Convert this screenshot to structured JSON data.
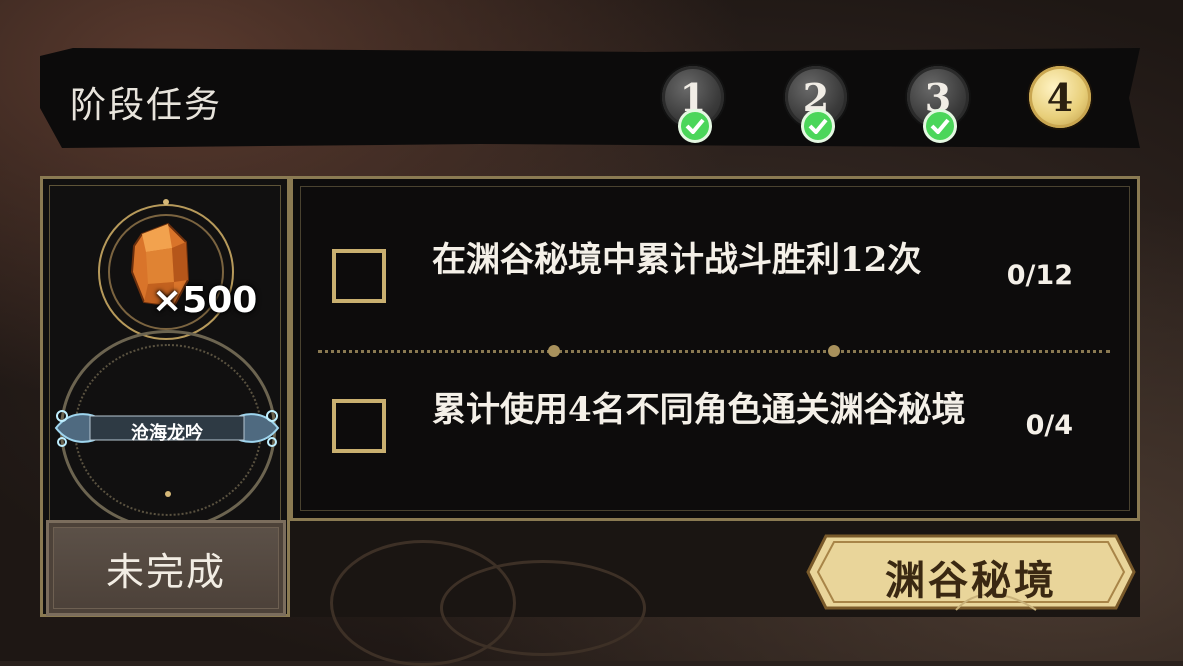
{
  "header": {
    "title": "阶段任务",
    "stages": [
      {
        "label": "1",
        "completed": true
      },
      {
        "label": "2",
        "completed": true
      },
      {
        "label": "3",
        "completed": true
      },
      {
        "label": "4",
        "completed": false,
        "current": true
      }
    ]
  },
  "reward": {
    "icon": "orange-crystal-icon",
    "quantity": "×500",
    "title_badge": "沧海龙吟",
    "status": "未完成"
  },
  "tasks": [
    {
      "text": "在渊谷秘境中累计战斗胜利12次",
      "progress": "0/12",
      "checked": false
    },
    {
      "text": "累计使用4名不同角色通关渊谷秘境",
      "progress": "0/4",
      "checked": false
    }
  ],
  "actions": {
    "go_label": "渊谷秘境"
  },
  "colors": {
    "accent_gold": "#e8cf7a",
    "check_green": "#4bd65a",
    "frame_gold": "#8a7a52"
  }
}
